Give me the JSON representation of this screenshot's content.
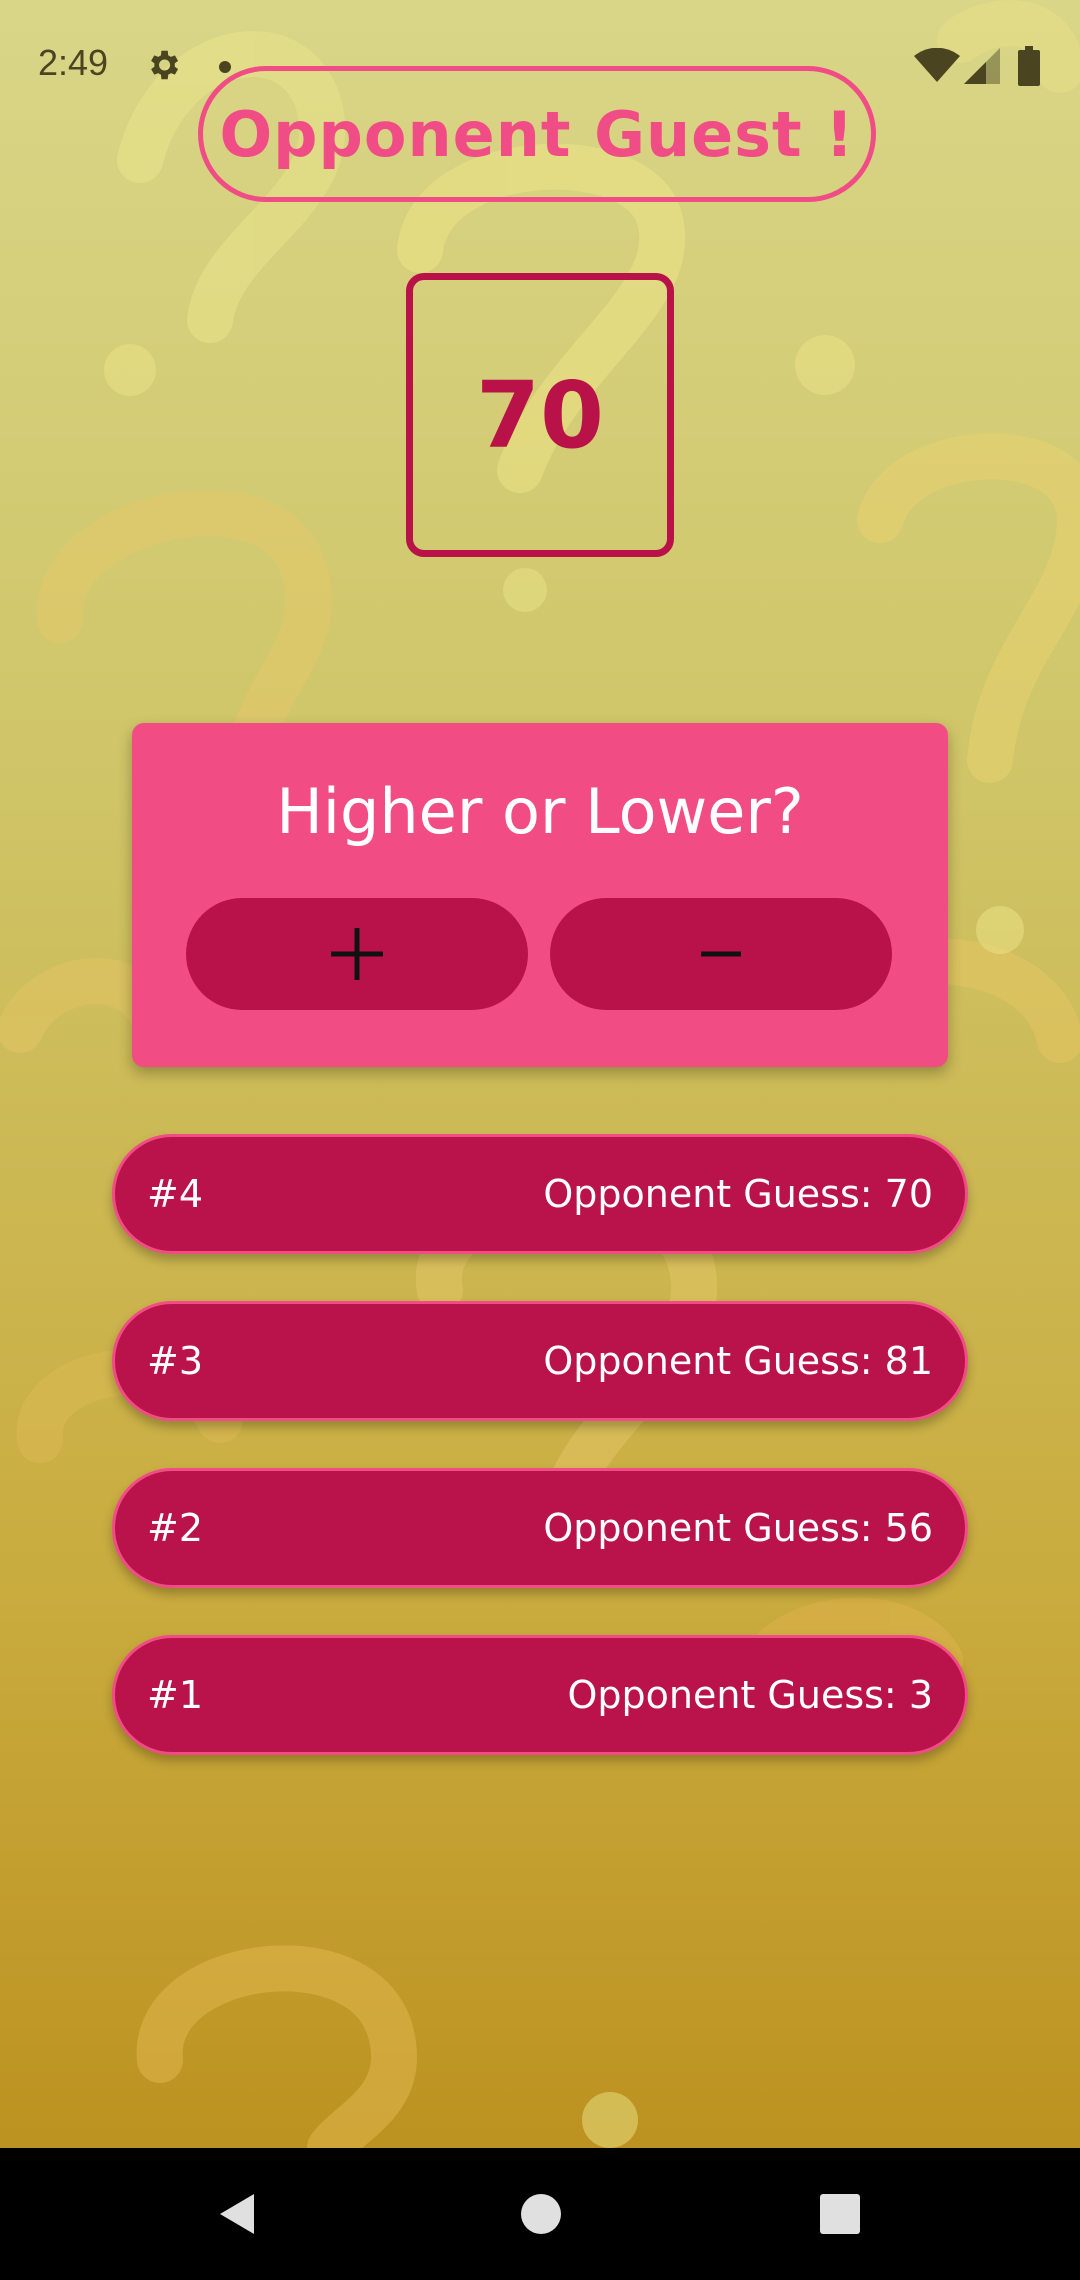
{
  "status_bar": {
    "time": "2:49",
    "icons": [
      "settings-icon",
      "notification-dot",
      "wifi-icon",
      "signal-icon",
      "battery-icon"
    ]
  },
  "header": {
    "title": "Opponent Guest !"
  },
  "current_guess": {
    "value": "70"
  },
  "hint_card": {
    "title": "Higher or Lower?",
    "buttons": [
      {
        "name": "plus-button",
        "icon": "plus-icon"
      },
      {
        "name": "minus-button",
        "icon": "minus-icon"
      }
    ]
  },
  "guess_log": [
    {
      "index": "#4",
      "text": "Opponent Guess: 70"
    },
    {
      "index": "#3",
      "text": "Opponent Guess: 81"
    },
    {
      "index": "#2",
      "text": "Opponent Guess: 56"
    },
    {
      "index": "#1",
      "text": "Opponent Guess: 3"
    }
  ],
  "nav_bar": {
    "icons": [
      "back-icon",
      "home-icon",
      "recents-icon"
    ]
  },
  "colors": {
    "accent_pink": "#f04c85",
    "accent_crimson": "#b9124a",
    "background_top": "#d9d688",
    "background_bottom": "#b98c19"
  }
}
